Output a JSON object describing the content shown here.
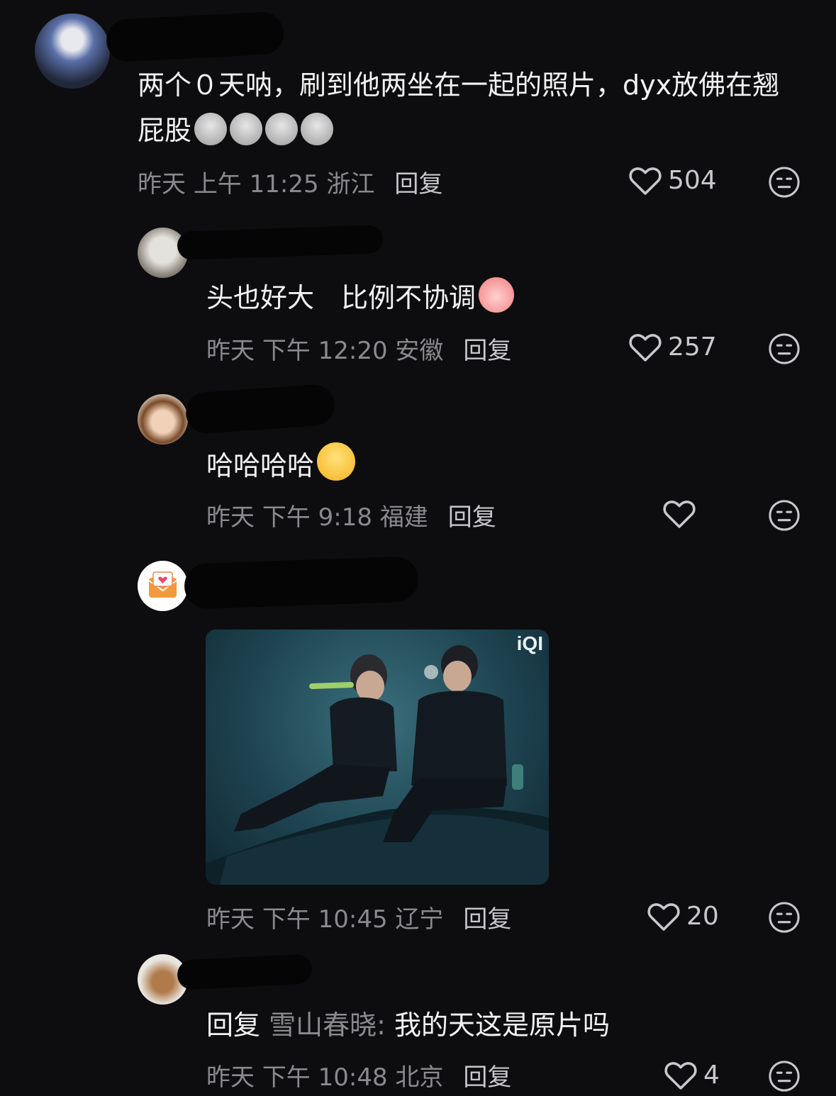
{
  "comments": [
    {
      "text": "两个０天呐，刷到他两坐在一起的照片，dyx放佛在翘屁股",
      "date": "昨天",
      "time": "上午 11:25",
      "location": "浙江",
      "reply": "回复",
      "likes": "504"
    },
    {
      "text": "头也好大　比例不协调",
      "date": "昨天",
      "time": "下午 12:20",
      "location": "安徽",
      "reply": "回复",
      "likes": "257"
    },
    {
      "text": "哈哈哈哈",
      "date": "昨天",
      "time": "下午 9:18",
      "location": "福建",
      "reply": "回复",
      "likes": ""
    },
    {
      "image_watermark": "iQI",
      "date": "昨天",
      "time": "下午 10:45",
      "location": "辽宁",
      "reply": "回复",
      "likes": "20"
    },
    {
      "reply_prefix": "回复",
      "reply_to": "雪山春晓:",
      "text": "我的天这是原片吗",
      "date": "昨天",
      "time": "下午 10:48",
      "location": "北京",
      "reply": "回复",
      "likes": "4"
    }
  ],
  "icons": {
    "like": "heart-icon",
    "dislike": "meh-face-icon",
    "emoji": "emoji-icon"
  },
  "colors": {
    "background": "#0d0d0f",
    "text": "#f2f2f2",
    "muted": "#8a8a8e"
  }
}
